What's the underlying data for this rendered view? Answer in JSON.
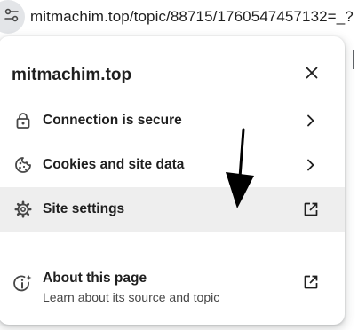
{
  "address_bar": {
    "url": "mitmachim.top/topic/88715/1760547457132=_?",
    "site_info_icon": "tune-icon"
  },
  "popup": {
    "title": "mitmachim.top",
    "close_icon": "close-icon",
    "items": [
      {
        "label": "Connection is secure",
        "icon": "lock-icon",
        "trail": "chevron-right-icon"
      },
      {
        "label": "Cookies and site data",
        "icon": "cookie-icon",
        "trail": "chevron-right-icon"
      },
      {
        "label": "Site settings",
        "icon": "gear-icon",
        "trail": "open-external-icon"
      }
    ],
    "about": {
      "label": "About this page",
      "sublabel": "Learn about its source and topic",
      "icon": "info-sparkle-icon",
      "trail": "open-external-icon"
    }
  },
  "annotation": {
    "icon": "down-arrow-icon"
  },
  "colors": {
    "text": "#1f1f1f",
    "icon": "#474747",
    "hover_bg": "#eeeeee",
    "divider": "#c7d7dd"
  }
}
